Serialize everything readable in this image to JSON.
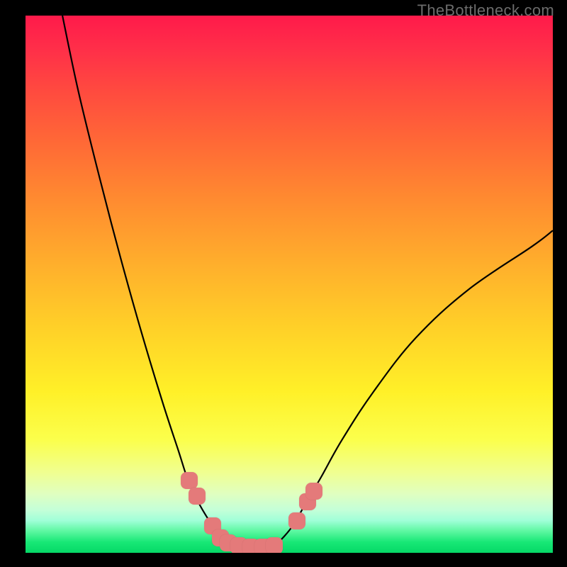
{
  "watermark": "TheBottleneck.com",
  "chart_data": {
    "type": "line",
    "title": "",
    "xlabel": "",
    "ylabel": "",
    "xlim": [
      0,
      100
    ],
    "ylim": [
      0,
      100
    ],
    "grid": false,
    "legend": false,
    "series": [
      {
        "name": "curve-left",
        "x": [
          7,
          10,
          14,
          18,
          22,
          26,
          29,
          31,
          33,
          34.5,
          36,
          37,
          38,
          39,
          41,
          45
        ],
        "y": [
          100,
          86,
          70,
          55,
          41,
          28,
          19,
          13,
          9,
          6.5,
          4.2,
          3.0,
          2.2,
          1.6,
          0.8,
          0.3
        ]
      },
      {
        "name": "curve-right",
        "x": [
          45,
          47,
          49,
          51,
          53,
          56,
          60,
          66,
          74,
          84,
          96,
          100
        ],
        "y": [
          0.3,
          1.2,
          3.0,
          5.5,
          9.0,
          14,
          21,
          30,
          40,
          49,
          57,
          60
        ]
      }
    ],
    "markers": [
      {
        "x": 31.0,
        "y": 13.5
      },
      {
        "x": 32.5,
        "y": 10.5
      },
      {
        "x": 35.5,
        "y": 5.0
      },
      {
        "x": 37.0,
        "y": 2.8
      },
      {
        "x": 38.5,
        "y": 1.8
      },
      {
        "x": 40.5,
        "y": 1.3
      },
      {
        "x": 42.8,
        "y": 1.0
      },
      {
        "x": 45.0,
        "y": 1.0
      },
      {
        "x": 47.2,
        "y": 1.3
      },
      {
        "x": 51.5,
        "y": 6.0
      },
      {
        "x": 53.5,
        "y": 9.5
      },
      {
        "x": 54.7,
        "y": 11.5
      }
    ],
    "colors": {
      "curve": "#000000",
      "marker": "#e47a7a"
    }
  }
}
